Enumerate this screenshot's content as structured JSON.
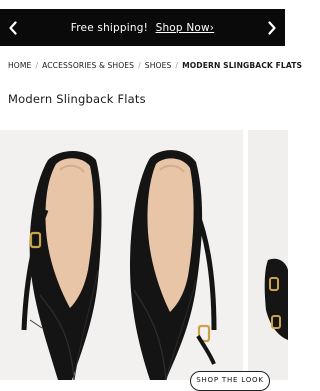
{
  "promo": {
    "text": "Free shipping!",
    "link_label": "Shop Now›",
    "prev_icon": "chevron-left-icon",
    "next_icon": "chevron-right-icon"
  },
  "breadcrumb": {
    "items": [
      "HOME",
      "ACCESSORIES & SHOES",
      "SHOES"
    ],
    "current": "MODERN SLINGBACK FLATS",
    "separator": "/"
  },
  "product": {
    "title": "Modern Slingback Flats",
    "shop_look_label": "SHOP THE LOOK"
  },
  "colors": {
    "promo_bg": "#0a0a0a",
    "photo_bg": "#f2f1f0",
    "shoe_leather": "#111111",
    "shoe_lining": "#e8c5a6",
    "buckle": "#c9a24a"
  }
}
